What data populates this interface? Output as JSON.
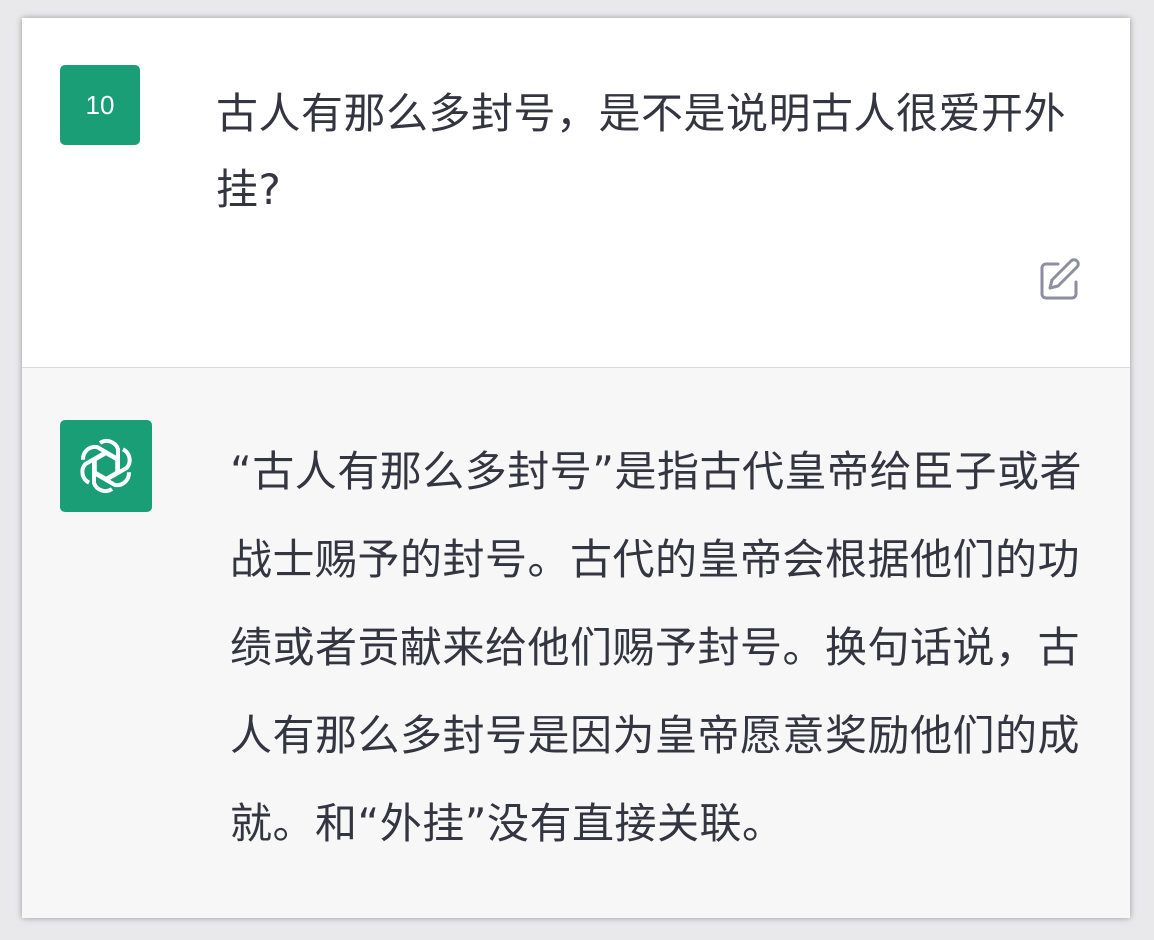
{
  "user_message": {
    "avatar_label": "10",
    "text": "古人有那么多封号，是不是说明古人很爱开外挂?",
    "icon": "edit-icon"
  },
  "assistant_message": {
    "avatar_icon": "openai-logo-icon",
    "text": "“古人有那么多封号”是指古代皇帝给臣子或者战士赐予的封号。古代的皇帝会根据他们的功绩或者贡献来给他们赐予封号。换句话说，古人有那么多封号是因为皇帝愿意奖励他们的成就。和“外挂”没有直接关联。"
  },
  "colors": {
    "avatar_bg": "#1a9e76",
    "user_bg": "#ffffff",
    "assistant_bg": "#f7f7f8",
    "text": "#343541"
  }
}
